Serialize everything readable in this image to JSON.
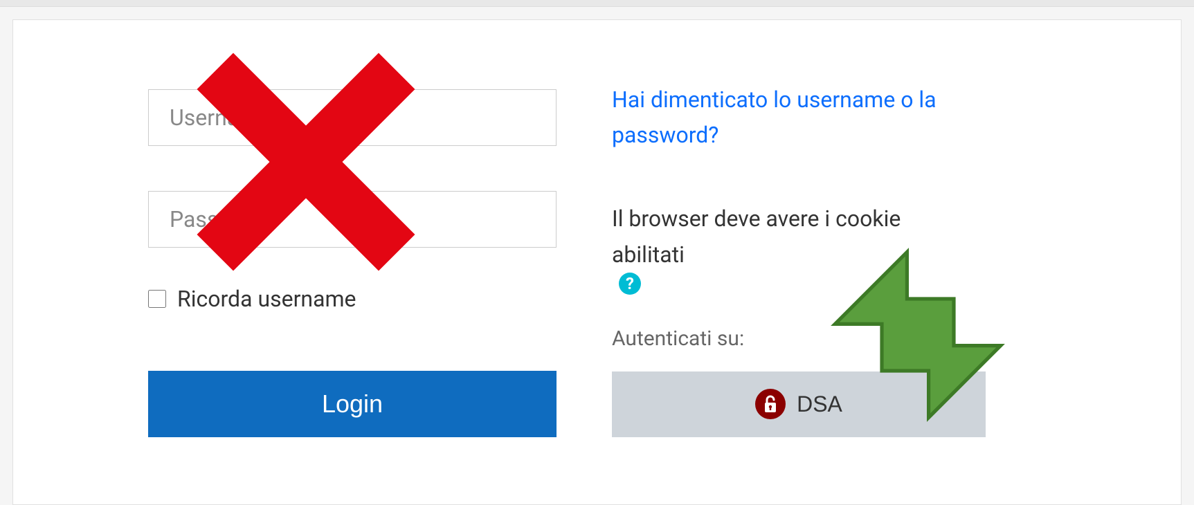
{
  "login": {
    "username_placeholder": "Username",
    "password_placeholder": "Password",
    "remember_label": "Ricorda username",
    "login_button": "Login"
  },
  "side": {
    "forgot_link": "Hai dimenticato lo username o la password?",
    "cookie_text": "Il browser deve avere i cookie abilitati",
    "help_icon": "?",
    "auth_label": "Autenticati su:",
    "dsa_label": "DSA"
  },
  "colors": {
    "red": "#e30613",
    "green": "#5a9e3d",
    "blue_btn": "#0f6cbf",
    "link_blue": "#0d6efd",
    "lock_bg": "#8b0000",
    "cyan": "#00bcd4"
  }
}
